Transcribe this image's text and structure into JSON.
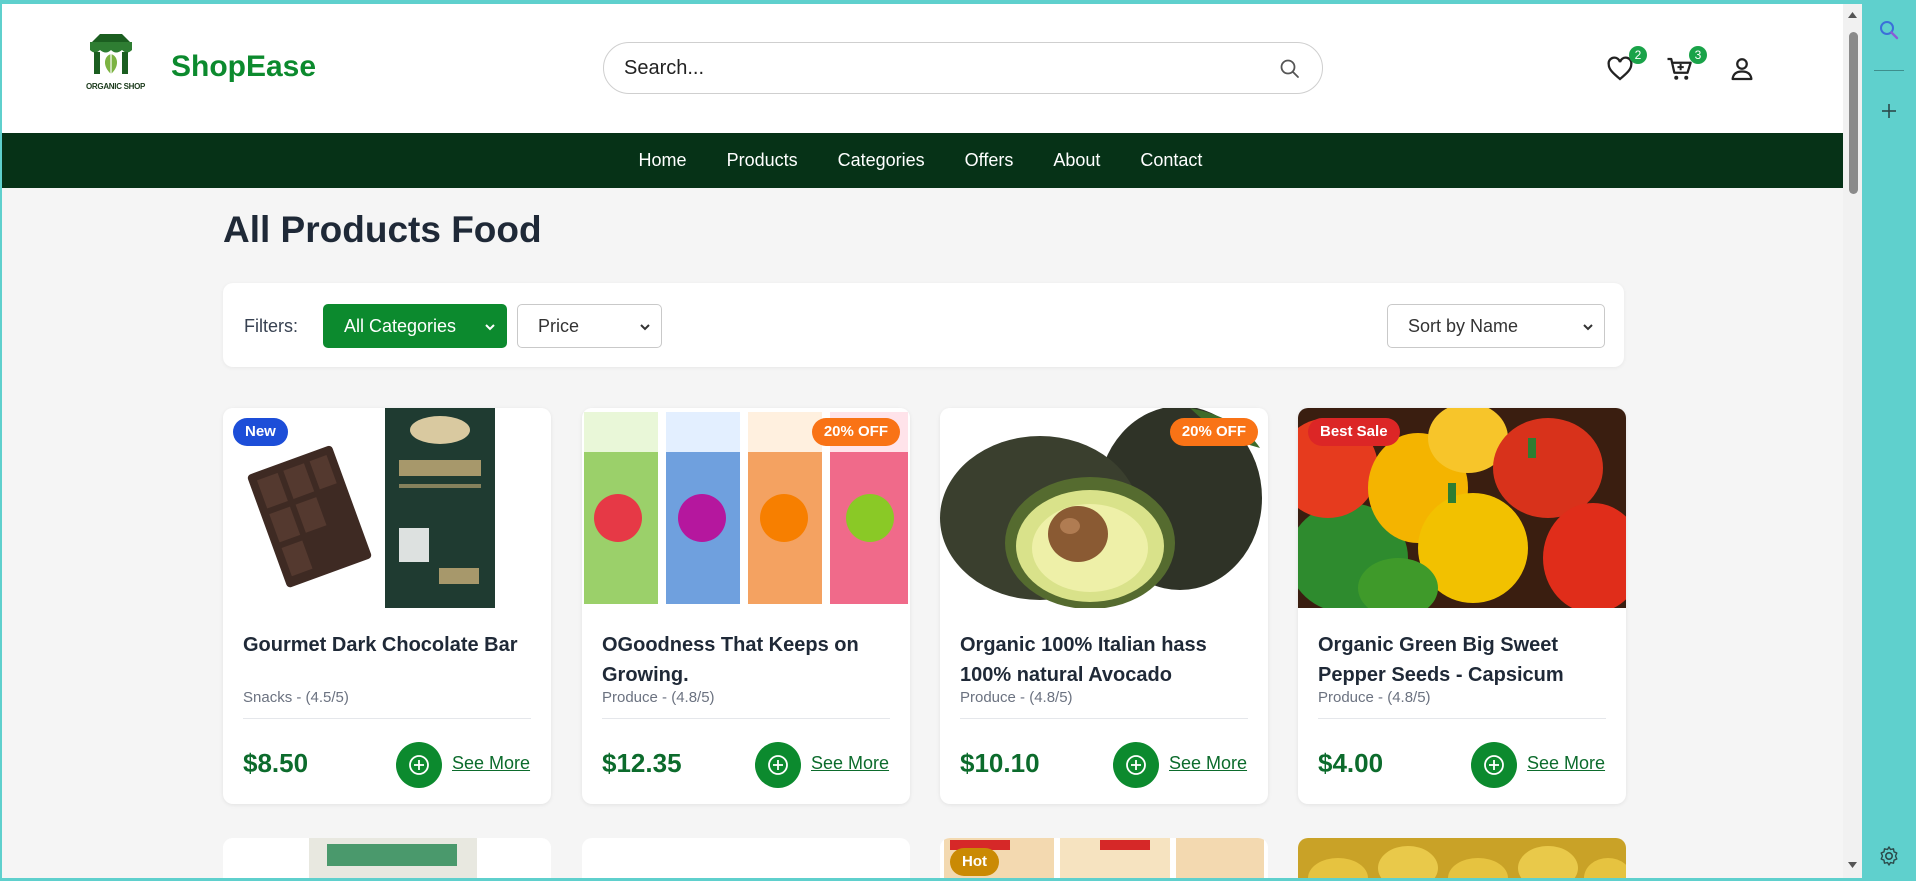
{
  "header": {
    "logo_text": "ORGANIC SHOP",
    "brand": "ShopEase",
    "search_placeholder": "Search...",
    "wishlist_count": "2",
    "cart_count": "3"
  },
  "nav": {
    "items": [
      {
        "label": "Home"
      },
      {
        "label": "Products"
      },
      {
        "label": "Categories"
      },
      {
        "label": "Offers"
      },
      {
        "label": "About"
      },
      {
        "label": "Contact"
      }
    ]
  },
  "page": {
    "title": "All Products Food"
  },
  "filters": {
    "label": "Filters:",
    "category": "All Categories",
    "price": "Price",
    "sort": "Sort by Name"
  },
  "products": [
    {
      "badge": "New",
      "badge_color": "#1d4ed8",
      "title": "Gourmet Dark Chocolate Bar",
      "meta": "Snacks - (4.5/5)",
      "price": "$8.50",
      "action": "See More"
    },
    {
      "badge": "20% OFF",
      "badge_color": "#f97316",
      "title": "OGoodness That Keeps on Growing.",
      "meta": "Produce - (4.8/5)",
      "price": "$12.35",
      "action": "See More"
    },
    {
      "badge": "20% OFF",
      "badge_color": "#f97316",
      "title": "Organic 100% Italian hass 100% natural Avocado",
      "meta": "Produce - (4.8/5)",
      "price": "$10.10",
      "action": "See More"
    },
    {
      "badge": "Best Sale",
      "badge_color": "#dc2626",
      "title": "Organic Green Big Sweet Pepper Seeds - Capsicum",
      "meta": "Produce - (4.8/5)",
      "price": "$4.00",
      "action": "See More"
    }
  ],
  "next_row": {
    "hot_badge": "Hot"
  },
  "colors": {
    "brand_green": "#0c8a2e",
    "nav_bg": "#063217"
  }
}
